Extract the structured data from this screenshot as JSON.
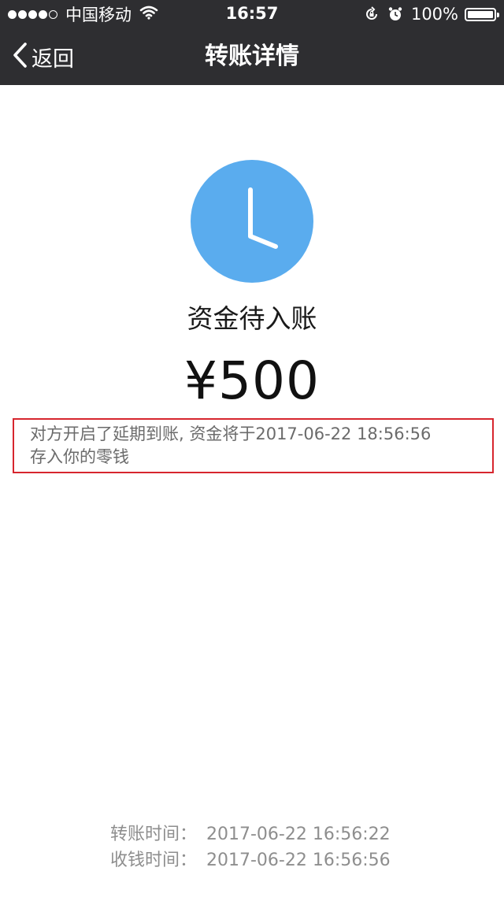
{
  "status_bar": {
    "carrier": "中国移动",
    "time": "16:57",
    "battery": "100%",
    "battery_level": 1.0
  },
  "nav": {
    "back_label": "返回",
    "title": "转账详情"
  },
  "transfer": {
    "status_icon": "clock-icon",
    "status_color": "#5aacee",
    "status_text": "资金待入账",
    "amount": "¥500",
    "notice_line1": "对方开启了延期到账, 资金将于2017-06-22 18:56:56",
    "notice_line2": "存入你的零钱"
  },
  "details": [
    {
      "label": "转账时间：",
      "value": "2017-06-22 16:56:22"
    },
    {
      "label": "收钱时间：",
      "value": "2017-06-22 16:56:56"
    }
  ]
}
